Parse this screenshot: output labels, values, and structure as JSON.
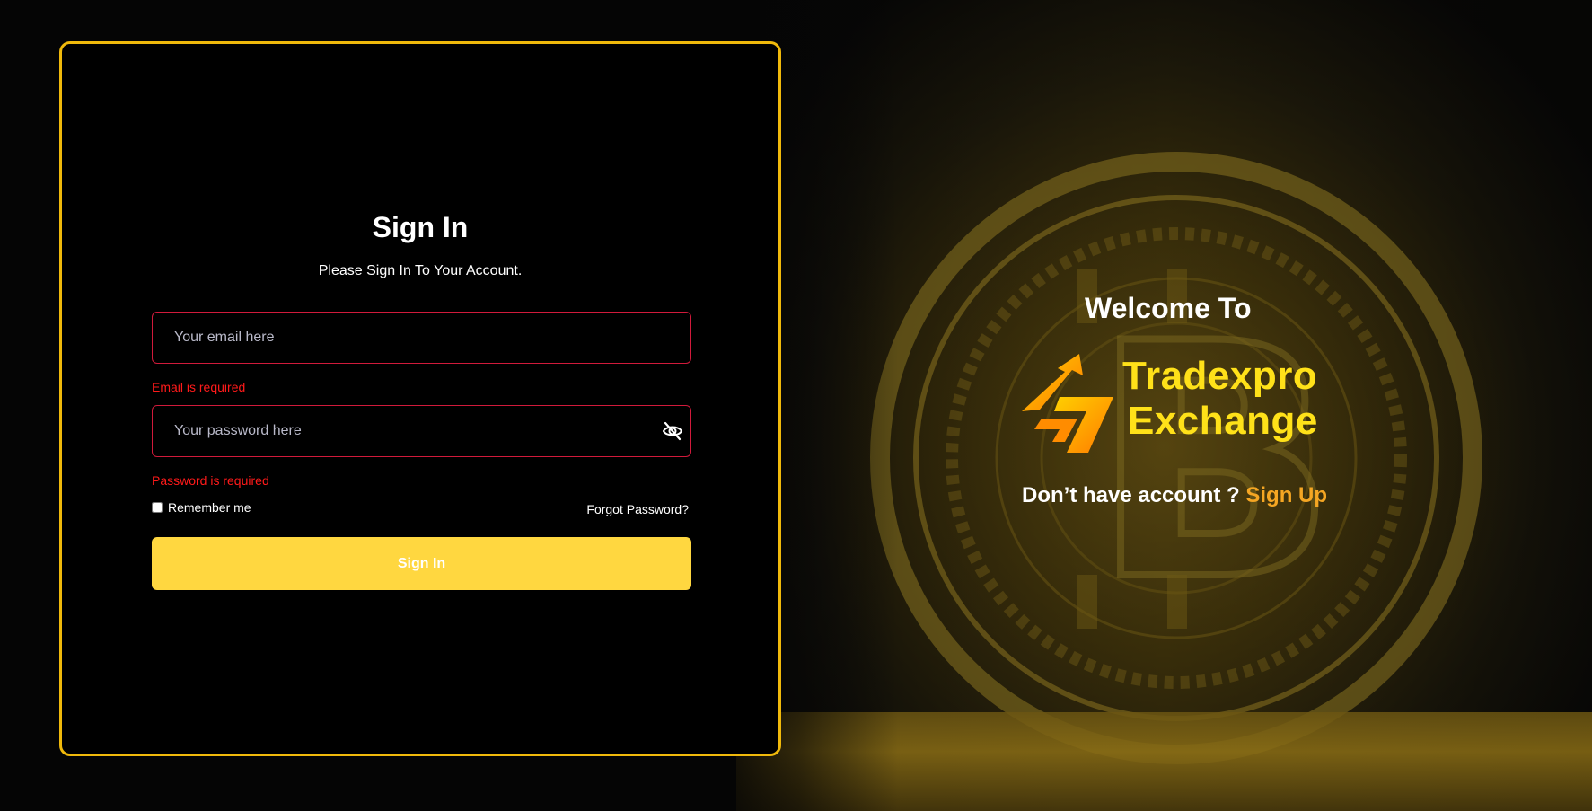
{
  "signin": {
    "title": "Sign In",
    "subtitle": "Please Sign In To Your Account.",
    "email_placeholder": "Your email here",
    "email_error": "Email is required",
    "password_placeholder": "Your password here",
    "password_error": "Password is required",
    "remember_label": "Remember me",
    "remember_checked": false,
    "forgot_label": "Forgot Password?",
    "button_label": "Sign In",
    "password_toggle_icon": "eye-slash-icon"
  },
  "promo": {
    "welcome": "Welcome To",
    "brand_line1": "Tradexpro",
    "brand_line2": "Exchange",
    "account_prompt": "Don’t have account ?",
    "signup_label": "Sign Up",
    "logo_icon": "tradexpro-logo-icon"
  },
  "colors": {
    "accent_border": "#f0b90b",
    "button_bg": "#ffd740",
    "error": "#ff1a1a",
    "input_border": "#d11a3b",
    "brand_text": "#ffe119",
    "signup_link": "#f5a623"
  }
}
